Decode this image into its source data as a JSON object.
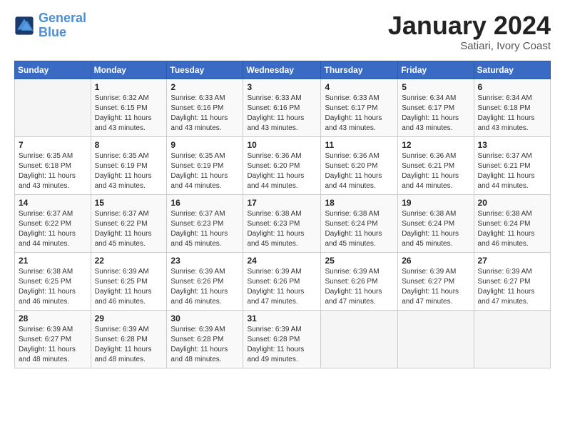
{
  "logo": {
    "line1": "General",
    "line2": "Blue"
  },
  "header": {
    "month": "January 2024",
    "location": "Satiari, Ivory Coast"
  },
  "weekdays": [
    "Sunday",
    "Monday",
    "Tuesday",
    "Wednesday",
    "Thursday",
    "Friday",
    "Saturday"
  ],
  "weeks": [
    [
      {
        "day": "",
        "sunrise": "",
        "sunset": "",
        "daylight": ""
      },
      {
        "day": "1",
        "sunrise": "Sunrise: 6:32 AM",
        "sunset": "Sunset: 6:15 PM",
        "daylight": "Daylight: 11 hours and 43 minutes."
      },
      {
        "day": "2",
        "sunrise": "Sunrise: 6:33 AM",
        "sunset": "Sunset: 6:16 PM",
        "daylight": "Daylight: 11 hours and 43 minutes."
      },
      {
        "day": "3",
        "sunrise": "Sunrise: 6:33 AM",
        "sunset": "Sunset: 6:16 PM",
        "daylight": "Daylight: 11 hours and 43 minutes."
      },
      {
        "day": "4",
        "sunrise": "Sunrise: 6:33 AM",
        "sunset": "Sunset: 6:17 PM",
        "daylight": "Daylight: 11 hours and 43 minutes."
      },
      {
        "day": "5",
        "sunrise": "Sunrise: 6:34 AM",
        "sunset": "Sunset: 6:17 PM",
        "daylight": "Daylight: 11 hours and 43 minutes."
      },
      {
        "day": "6",
        "sunrise": "Sunrise: 6:34 AM",
        "sunset": "Sunset: 6:18 PM",
        "daylight": "Daylight: 11 hours and 43 minutes."
      }
    ],
    [
      {
        "day": "7",
        "sunrise": "Sunrise: 6:35 AM",
        "sunset": "Sunset: 6:18 PM",
        "daylight": "Daylight: 11 hours and 43 minutes."
      },
      {
        "day": "8",
        "sunrise": "Sunrise: 6:35 AM",
        "sunset": "Sunset: 6:19 PM",
        "daylight": "Daylight: 11 hours and 43 minutes."
      },
      {
        "day": "9",
        "sunrise": "Sunrise: 6:35 AM",
        "sunset": "Sunset: 6:19 PM",
        "daylight": "Daylight: 11 hours and 44 minutes."
      },
      {
        "day": "10",
        "sunrise": "Sunrise: 6:36 AM",
        "sunset": "Sunset: 6:20 PM",
        "daylight": "Daylight: 11 hours and 44 minutes."
      },
      {
        "day": "11",
        "sunrise": "Sunrise: 6:36 AM",
        "sunset": "Sunset: 6:20 PM",
        "daylight": "Daylight: 11 hours and 44 minutes."
      },
      {
        "day": "12",
        "sunrise": "Sunrise: 6:36 AM",
        "sunset": "Sunset: 6:21 PM",
        "daylight": "Daylight: 11 hours and 44 minutes."
      },
      {
        "day": "13",
        "sunrise": "Sunrise: 6:37 AM",
        "sunset": "Sunset: 6:21 PM",
        "daylight": "Daylight: 11 hours and 44 minutes."
      }
    ],
    [
      {
        "day": "14",
        "sunrise": "Sunrise: 6:37 AM",
        "sunset": "Sunset: 6:22 PM",
        "daylight": "Daylight: 11 hours and 44 minutes."
      },
      {
        "day": "15",
        "sunrise": "Sunrise: 6:37 AM",
        "sunset": "Sunset: 6:22 PM",
        "daylight": "Daylight: 11 hours and 45 minutes."
      },
      {
        "day": "16",
        "sunrise": "Sunrise: 6:37 AM",
        "sunset": "Sunset: 6:23 PM",
        "daylight": "Daylight: 11 hours and 45 minutes."
      },
      {
        "day": "17",
        "sunrise": "Sunrise: 6:38 AM",
        "sunset": "Sunset: 6:23 PM",
        "daylight": "Daylight: 11 hours and 45 minutes."
      },
      {
        "day": "18",
        "sunrise": "Sunrise: 6:38 AM",
        "sunset": "Sunset: 6:24 PM",
        "daylight": "Daylight: 11 hours and 45 minutes."
      },
      {
        "day": "19",
        "sunrise": "Sunrise: 6:38 AM",
        "sunset": "Sunset: 6:24 PM",
        "daylight": "Daylight: 11 hours and 45 minutes."
      },
      {
        "day": "20",
        "sunrise": "Sunrise: 6:38 AM",
        "sunset": "Sunset: 6:24 PM",
        "daylight": "Daylight: 11 hours and 46 minutes."
      }
    ],
    [
      {
        "day": "21",
        "sunrise": "Sunrise: 6:38 AM",
        "sunset": "Sunset: 6:25 PM",
        "daylight": "Daylight: 11 hours and 46 minutes."
      },
      {
        "day": "22",
        "sunrise": "Sunrise: 6:39 AM",
        "sunset": "Sunset: 6:25 PM",
        "daylight": "Daylight: 11 hours and 46 minutes."
      },
      {
        "day": "23",
        "sunrise": "Sunrise: 6:39 AM",
        "sunset": "Sunset: 6:26 PM",
        "daylight": "Daylight: 11 hours and 46 minutes."
      },
      {
        "day": "24",
        "sunrise": "Sunrise: 6:39 AM",
        "sunset": "Sunset: 6:26 PM",
        "daylight": "Daylight: 11 hours and 47 minutes."
      },
      {
        "day": "25",
        "sunrise": "Sunrise: 6:39 AM",
        "sunset": "Sunset: 6:26 PM",
        "daylight": "Daylight: 11 hours and 47 minutes."
      },
      {
        "day": "26",
        "sunrise": "Sunrise: 6:39 AM",
        "sunset": "Sunset: 6:27 PM",
        "daylight": "Daylight: 11 hours and 47 minutes."
      },
      {
        "day": "27",
        "sunrise": "Sunrise: 6:39 AM",
        "sunset": "Sunset: 6:27 PM",
        "daylight": "Daylight: 11 hours and 47 minutes."
      }
    ],
    [
      {
        "day": "28",
        "sunrise": "Sunrise: 6:39 AM",
        "sunset": "Sunset: 6:27 PM",
        "daylight": "Daylight: 11 hours and 48 minutes."
      },
      {
        "day": "29",
        "sunrise": "Sunrise: 6:39 AM",
        "sunset": "Sunset: 6:28 PM",
        "daylight": "Daylight: 11 hours and 48 minutes."
      },
      {
        "day": "30",
        "sunrise": "Sunrise: 6:39 AM",
        "sunset": "Sunset: 6:28 PM",
        "daylight": "Daylight: 11 hours and 48 minutes."
      },
      {
        "day": "31",
        "sunrise": "Sunrise: 6:39 AM",
        "sunset": "Sunset: 6:28 PM",
        "daylight": "Daylight: 11 hours and 49 minutes."
      },
      {
        "day": "",
        "sunrise": "",
        "sunset": "",
        "daylight": ""
      },
      {
        "day": "",
        "sunrise": "",
        "sunset": "",
        "daylight": ""
      },
      {
        "day": "",
        "sunrise": "",
        "sunset": "",
        "daylight": ""
      }
    ]
  ]
}
